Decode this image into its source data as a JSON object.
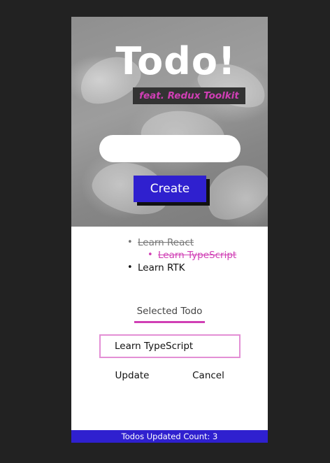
{
  "header": {
    "title": "Todo!",
    "subtitle": "feat. Redux Toolkit",
    "background_image": "grayscale-lily-flower-photo"
  },
  "create_form": {
    "input_value": "",
    "button_label": "Create"
  },
  "todos": [
    {
      "label": "Learn React",
      "completed": true,
      "selected": false
    },
    {
      "label": "Learn TypeScript",
      "completed": true,
      "selected": true
    },
    {
      "label": "Learn RTK",
      "completed": false,
      "selected": false
    }
  ],
  "bullet": "•",
  "edit_panel": {
    "heading": "Selected Todo",
    "input_value": "Learn TypeScript",
    "update_label": "Update",
    "cancel_label": "Cancel"
  },
  "footer": {
    "text": "Todos Updated Count: 3"
  },
  "colors": {
    "page_background": "#222222",
    "accent_pink": "#d03fb5",
    "accent_blue": "#2f20cf",
    "completed_gray": "#777777"
  }
}
